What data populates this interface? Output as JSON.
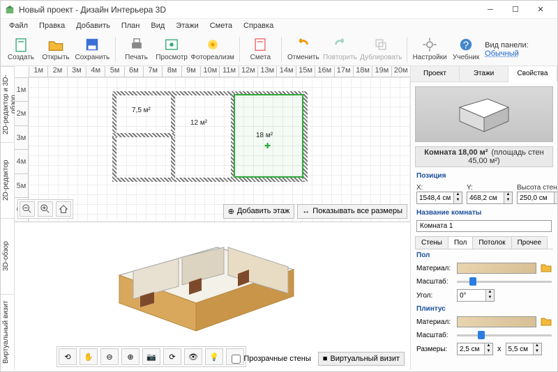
{
  "window": {
    "title": "Новый проект - Дизайн Интерьера 3D"
  },
  "menu": [
    "Файл",
    "Правка",
    "Добавить",
    "План",
    "Вид",
    "Этажи",
    "Смета",
    "Справка"
  ],
  "toolbar": [
    {
      "icon": "doc",
      "label": "Создать"
    },
    {
      "icon": "open",
      "label": "Открыть"
    },
    {
      "icon": "save",
      "label": "Сохранить"
    },
    {
      "sep": true
    },
    {
      "icon": "print",
      "label": "Печать"
    },
    {
      "icon": "view",
      "label": "Просмотр"
    },
    {
      "icon": "photo",
      "label": "Фотореализм"
    },
    {
      "sep": true
    },
    {
      "icon": "est",
      "label": "Смета"
    },
    {
      "sep": true
    },
    {
      "icon": "undo",
      "label": "Отменить"
    },
    {
      "icon": "redo",
      "label": "Повторить",
      "disabled": true
    },
    {
      "icon": "dup",
      "label": "Дублировать",
      "disabled": true
    },
    {
      "sep": true
    },
    {
      "icon": "gear",
      "label": "Настройки"
    },
    {
      "icon": "help",
      "label": "Учебник"
    }
  ],
  "view_panel": {
    "label": "Вид панели:",
    "value": "Обычный"
  },
  "side_tabs": [
    "2D-редактор и 3D-обзор",
    "2D-редактор",
    "3D-обзор",
    "Виртуальный визит"
  ],
  "ruler_h": [
    "1м",
    "2м",
    "3м",
    "4м",
    "5м",
    "6м",
    "7м",
    "8м",
    "9м",
    "10м",
    "11м",
    "12м",
    "13м",
    "14м",
    "15м",
    "16м",
    "17м",
    "18м",
    "19м",
    "20м"
  ],
  "ruler_v": [
    "1м",
    "2м",
    "3м",
    "4м",
    "5м",
    "6м"
  ],
  "rooms": {
    "r1": "7,5 м²",
    "r2": "12 м²",
    "r3": "18 м²"
  },
  "plan_buttons": {
    "add_floor": "Добавить этаж",
    "show_dims": "Показывать все размеры"
  },
  "bottom": {
    "transparent": "Прозрачные стены",
    "virtual": "Виртуальный визит"
  },
  "panel_tabs": [
    "Проект",
    "Этажи",
    "Свойства"
  ],
  "info": {
    "room": "Комната 18,00 м²",
    "walls": "(площадь стен 45,00 м²)"
  },
  "position": {
    "heading": "Позиция",
    "x_label": "X:",
    "x": "1548,4 см",
    "y_label": "Y:",
    "y": "468,2 см",
    "wh_label": "Высота стен:",
    "wh": "250,0 см"
  },
  "roomname": {
    "heading": "Название комнаты",
    "value": "Комната 1"
  },
  "subtabs": [
    "Стены",
    "Пол",
    "Потолок",
    "Прочее"
  ],
  "floor": {
    "heading": "Пол",
    "material": "Материал:",
    "scale": "Масштаб:",
    "angle": "Угол:",
    "angle_val": "0°"
  },
  "plinth": {
    "heading": "Плинтус",
    "material": "Материал:",
    "scale": "Масштаб:",
    "sizes": "Размеры:",
    "w": "2,5 см",
    "sep": "x",
    "h": "5,5 см"
  }
}
